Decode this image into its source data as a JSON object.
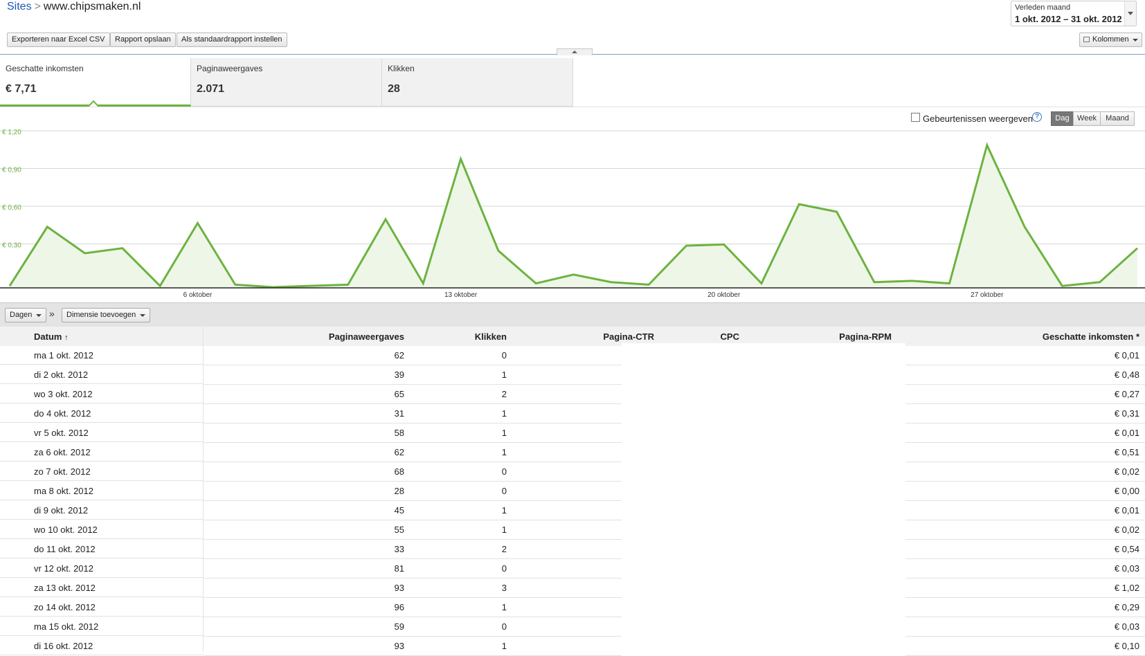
{
  "breadcrumb": {
    "parent": "Sites",
    "separator": ">",
    "current": "www.chipsmaken.nl"
  },
  "toolbar": {
    "export_label": "Exporteren naar Excel CSV",
    "save_label": "Rapport opslaan",
    "default_label": "Als standaardrapport instellen",
    "columns_label": "Kolommen"
  },
  "date_range": {
    "label": "Verleden maand",
    "value": "1 okt. 2012 – 31 okt. 2012"
  },
  "metrics": [
    {
      "label": "Geschatte inkomsten",
      "value": "€ 7,71",
      "active": true
    },
    {
      "label": "Paginaweergaves",
      "value": "2.071",
      "active": false
    },
    {
      "label": "Klikken",
      "value": "28",
      "active": false
    }
  ],
  "chart_controls": {
    "events_label": "Gebeurtenissen weergeven",
    "help": "?",
    "granularity": [
      "Dag",
      "Week",
      "Maand"
    ],
    "selected": "Dag"
  },
  "chart_data": {
    "type": "area",
    "series": [
      {
        "values": [
          0.01,
          0.48,
          0.27,
          0.31,
          0.01,
          0.51,
          0.02,
          0.0,
          0.01,
          0.02,
          0.54,
          0.03,
          1.02,
          0.29,
          0.03,
          0.1,
          0.04,
          0.02,
          0.33,
          0.34,
          0.03,
          0.66,
          0.6,
          0.04,
          0.05,
          0.03,
          1.13,
          0.48,
          0.01,
          0.04,
          0.31
        ]
      }
    ],
    "x": [
      1,
      2,
      3,
      4,
      5,
      6,
      7,
      8,
      9,
      10,
      11,
      12,
      13,
      14,
      15,
      16,
      17,
      18,
      19,
      20,
      21,
      22,
      23,
      24,
      25,
      26,
      27,
      28,
      29,
      30,
      31
    ],
    "x_tick_labels": [
      "6 oktober",
      "13 oktober",
      "20 oktober",
      "27 oktober"
    ],
    "x_tick_days": [
      6,
      13,
      20,
      27
    ],
    "y_tick_labels": [
      "€ 1,20",
      "€ 0,90",
      "€ 0,60",
      "€ 0,30"
    ],
    "y_tick_values": [
      1.2,
      0.9,
      0.6,
      0.3
    ],
    "ylim": [
      0,
      1.2
    ],
    "line_color": "#6cb33f",
    "fill_color": "#eef6e8"
  },
  "dimension_bar": {
    "days_label": "Dagen",
    "chevron": "»",
    "add_dimension_label": "Dimensie toevoegen"
  },
  "table": {
    "headers": {
      "date": "Datum",
      "sort_arrow": "↑",
      "pageviews": "Paginaweergaves",
      "clicks": "Klikken",
      "ctr": "Pagina-CTR",
      "cpc": "CPC",
      "rpm": "Pagina-RPM",
      "earnings": "Geschatte inkomsten *"
    },
    "rows": [
      {
        "date": "ma 1 okt. 2012",
        "pageviews": "62",
        "clicks": "0",
        "earnings": "€ 0,01"
      },
      {
        "date": "di 2 okt. 2012",
        "pageviews": "39",
        "clicks": "1",
        "earnings": "€ 0,48"
      },
      {
        "date": "wo 3 okt. 2012",
        "pageviews": "65",
        "clicks": "2",
        "earnings": "€ 0,27"
      },
      {
        "date": "do 4 okt. 2012",
        "pageviews": "31",
        "clicks": "1",
        "earnings": "€ 0,31"
      },
      {
        "date": "vr 5 okt. 2012",
        "pageviews": "58",
        "clicks": "1",
        "earnings": "€ 0,01"
      },
      {
        "date": "za 6 okt. 2012",
        "pageviews": "62",
        "clicks": "1",
        "earnings": "€ 0,51"
      },
      {
        "date": "zo 7 okt. 2012",
        "pageviews": "68",
        "clicks": "0",
        "earnings": "€ 0,02"
      },
      {
        "date": "ma 8 okt. 2012",
        "pageviews": "28",
        "clicks": "0",
        "earnings": "€ 0,00"
      },
      {
        "date": "di 9 okt. 2012",
        "pageviews": "45",
        "clicks": "1",
        "earnings": "€ 0,01"
      },
      {
        "date": "wo 10 okt. 2012",
        "pageviews": "55",
        "clicks": "1",
        "earnings": "€ 0,02"
      },
      {
        "date": "do 11 okt. 2012",
        "pageviews": "33",
        "clicks": "2",
        "earnings": "€ 0,54"
      },
      {
        "date": "vr 12 okt. 2012",
        "pageviews": "81",
        "clicks": "0",
        "earnings": "€ 0,03"
      },
      {
        "date": "za 13 okt. 2012",
        "pageviews": "93",
        "clicks": "3",
        "earnings": "€ 1,02"
      },
      {
        "date": "zo 14 okt. 2012",
        "pageviews": "96",
        "clicks": "1",
        "earnings": "€ 0,29"
      },
      {
        "date": "ma 15 okt. 2012",
        "pageviews": "59",
        "clicks": "0",
        "earnings": "€ 0,03"
      },
      {
        "date": "di 16 okt. 2012",
        "pageviews": "93",
        "clicks": "1",
        "earnings": "€ 0,10"
      }
    ]
  }
}
